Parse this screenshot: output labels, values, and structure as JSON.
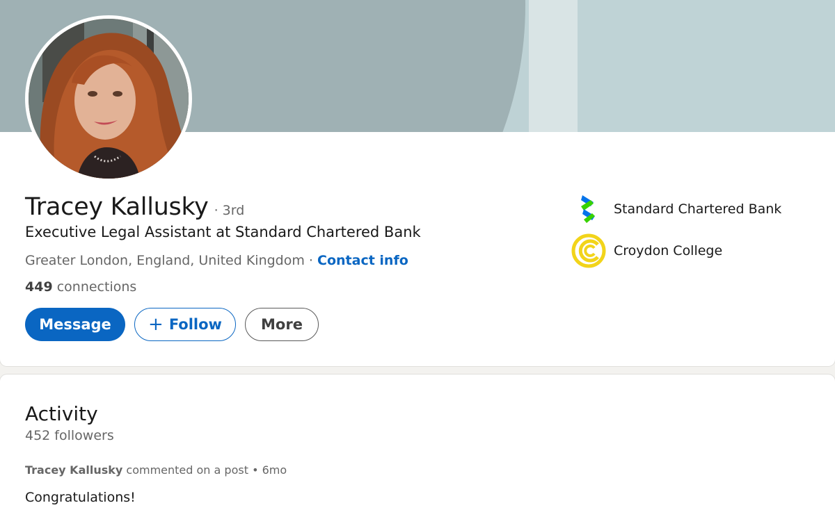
{
  "profile": {
    "name": "Tracey Kallusky",
    "degree": "· 3rd",
    "headline": "Executive Legal Assistant at Standard Chartered Bank",
    "location": "Greater London, England, United Kingdom",
    "location_separator": " · ",
    "contact_info_label": "Contact info",
    "connections_count": "449",
    "connections_label": " connections",
    "avatar_icon": "profile-photo"
  },
  "actions": {
    "message_label": "Message",
    "follow_label": "Follow",
    "follow_icon": "plus-icon",
    "more_label": "More"
  },
  "organizations": [
    {
      "name": "Standard Chartered Bank",
      "icon": "standard-chartered-logo"
    },
    {
      "name": "Croydon College",
      "icon": "croydon-college-logo"
    }
  ],
  "activity": {
    "title": "Activity",
    "followers": "452 followers",
    "post": {
      "author": "Tracey Kallusky",
      "meta": " commented on a post • 6mo",
      "text": "Congratulations!"
    }
  },
  "colors": {
    "brand_blue": "#0a66c2",
    "banner_dark": "#9fb1b4",
    "banner_light": "#bfd3d6",
    "croydon_yellow": "#f2d41a"
  }
}
